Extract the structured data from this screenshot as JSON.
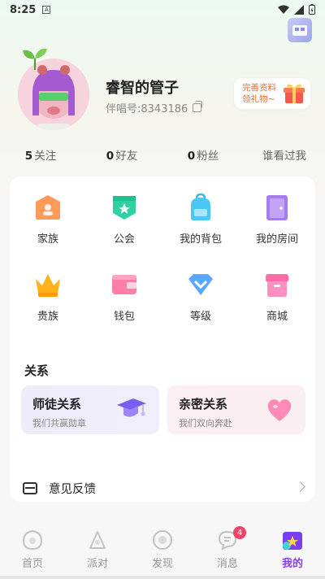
{
  "status": {
    "time": "8:25"
  },
  "profile": {
    "name": "睿智的管子",
    "id_text": "伴唱号:8343186",
    "gift_line1": "完善资料",
    "gift_line2": "领礼物~"
  },
  "stats": [
    {
      "num": "5",
      "label": "关注"
    },
    {
      "num": "0",
      "label": "好友"
    },
    {
      "num": "0",
      "label": "粉丝"
    },
    {
      "num": "",
      "label": "谁看过我"
    }
  ],
  "features": [
    {
      "label": "家族",
      "icon": "family-icon"
    },
    {
      "label": "公会",
      "icon": "guild-icon"
    },
    {
      "label": "我的背包",
      "icon": "backpack-icon"
    },
    {
      "label": "我的房间",
      "icon": "room-icon"
    },
    {
      "label": "贵族",
      "icon": "crown-icon"
    },
    {
      "label": "钱包",
      "icon": "wallet-icon"
    },
    {
      "label": "等级",
      "icon": "level-icon"
    },
    {
      "label": "商城",
      "icon": "mall-icon"
    }
  ],
  "relations": {
    "title": "关系",
    "mentor": {
      "title": "师徒关系",
      "subtitle": "我们共赢勋章"
    },
    "intimate": {
      "title": "亲密关系",
      "subtitle": "我们双向奔赴"
    }
  },
  "feedback": {
    "label": "意见反馈"
  },
  "tabs": [
    {
      "label": "首页"
    },
    {
      "label": "派对"
    },
    {
      "label": "发现"
    },
    {
      "label": "消息",
      "badge": "4"
    },
    {
      "label": "我的"
    }
  ],
  "colors": {
    "accent": "#8a3cf0",
    "badge": "#f2446a",
    "gift": "#f06a2a"
  }
}
